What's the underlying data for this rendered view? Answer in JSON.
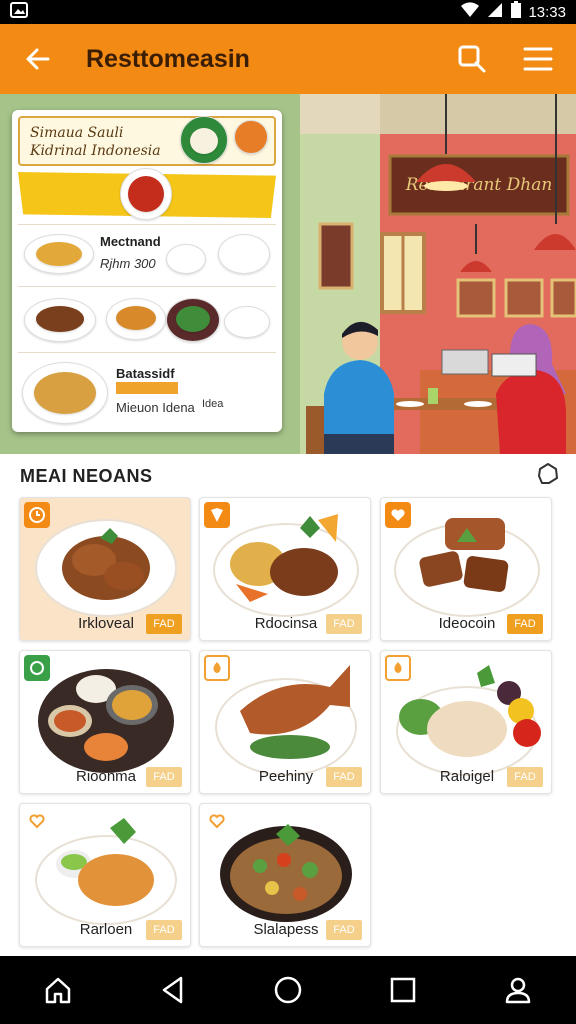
{
  "status": {
    "time": "13:33"
  },
  "appbar": {
    "title": "Resttomeasin"
  },
  "hero": {
    "menu_card": {
      "title_line1": "Simaua Sauli",
      "title_line2": "Kidrinal Indonesia",
      "row2_label": "Mectnand",
      "row2_sub": "Rjhm 300",
      "row4_label": "Batassidf",
      "row4_sub": "Mieuon Idena",
      "row4_price": "Idea"
    },
    "sign_text": "Restaurant Dhan"
  },
  "section": {
    "title": "MEAI NEOANS"
  },
  "menu_items": [
    {
      "name": "Irkloveal",
      "price": "FAD"
    },
    {
      "name": "Rdocinsa",
      "price": "FAD"
    },
    {
      "name": "Ideocoin",
      "price": "FAD"
    },
    {
      "name": "Rioonma",
      "price": "FAD"
    },
    {
      "name": "Peehiny",
      "price": "FAD"
    },
    {
      "name": "Raloigel",
      "price": "FAD"
    },
    {
      "name": "Rarloen",
      "price": "FAD"
    },
    {
      "name": "Slalapess",
      "price": "FAD"
    }
  ]
}
